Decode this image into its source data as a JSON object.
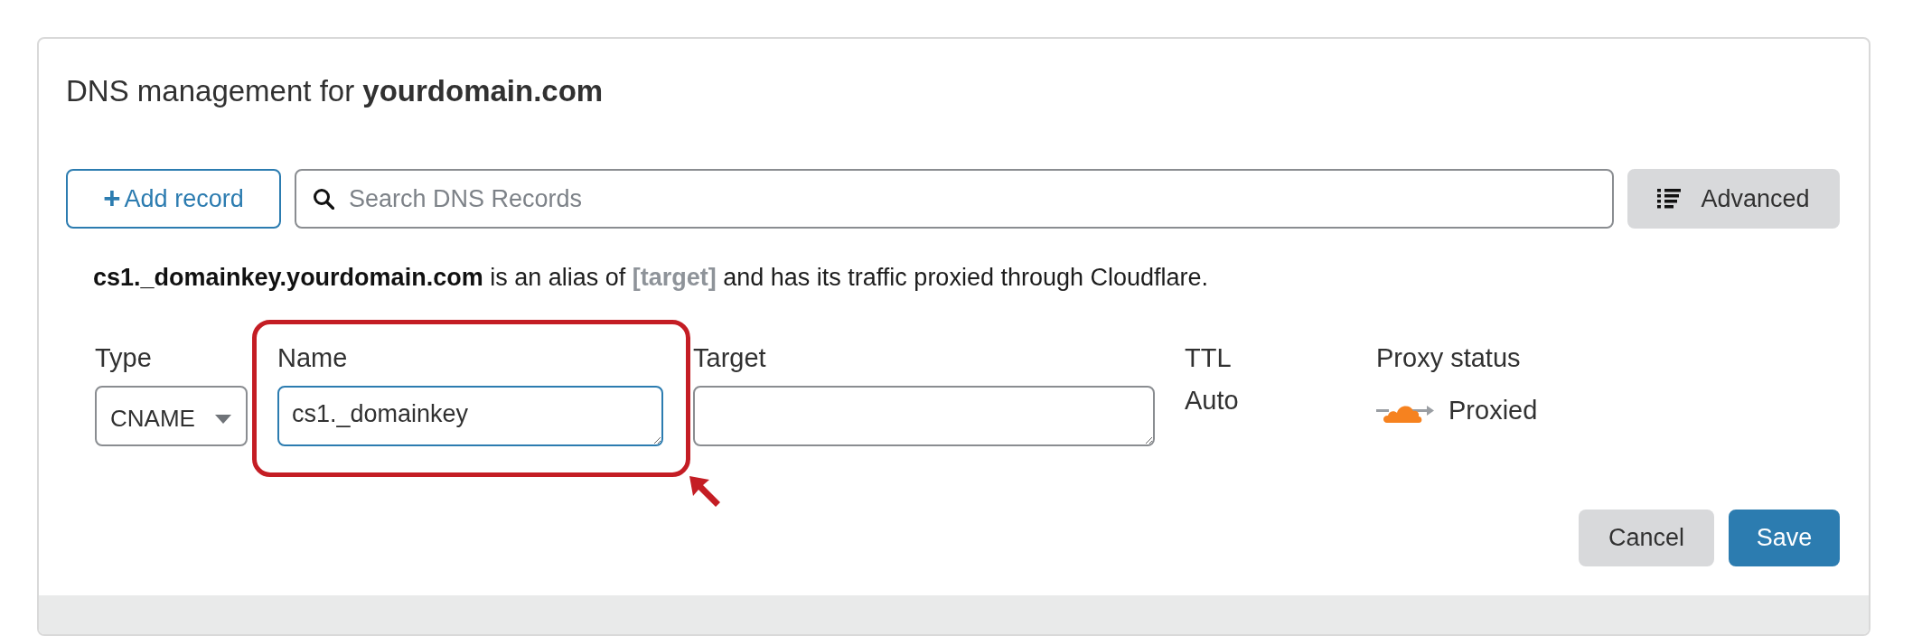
{
  "title": {
    "prefix": "DNS management for",
    "domain": "yourdomain.com"
  },
  "toolbar": {
    "add_button": {
      "icon": "+",
      "label": "Add record"
    },
    "search": {
      "placeholder": "Search DNS Records"
    },
    "advanced_button": {
      "label": "Advanced"
    }
  },
  "summary": "**cs1._domainkey.yourdomain.com** is an alias of **[target]** and has its traffic proxied through Cloudflare.",
  "fields": [
    {
      "kind": "select",
      "label": "Type",
      "value": "CNAME",
      "highlighted": false
    },
    {
      "kind": "textarea",
      "label": "Name",
      "value": "cs1._domainkey",
      "focused": true,
      "highlighted": true
    },
    {
      "kind": "textarea",
      "label": "Target",
      "focused": false,
      "highlighted": false
    },
    {
      "kind": "text",
      "label": "TTL",
      "value": "Auto",
      "highlighted": false
    },
    {
      "kind": "proxy",
      "label": "Proxy status",
      "value": "Proxied",
      "highlighted": false
    }
  ],
  "actions": [
    {
      "label": "Cancel",
      "kind": "secondary"
    },
    {
      "label": "Save",
      "kind": "primary"
    }
  ]
}
